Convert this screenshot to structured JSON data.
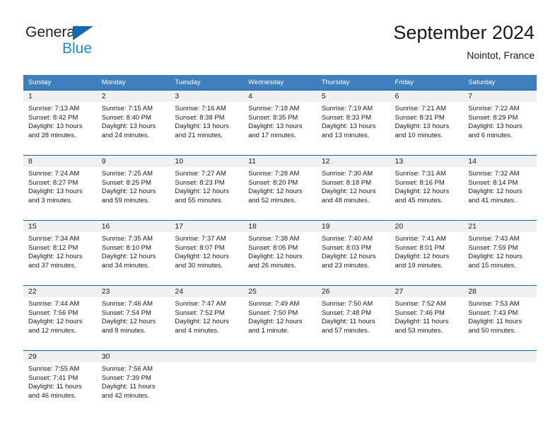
{
  "brand": {
    "line1": "General",
    "line2": "Blue",
    "triangle_color": "#1269b0"
  },
  "header": {
    "title": "September 2024",
    "location": "Nointot, France"
  },
  "colors": {
    "header_band": "#3f7fbf",
    "row_rule": "#1568ad",
    "daynum_band": "#f0f0f0",
    "brand_blue": "#1f88d8"
  },
  "weekday_headers": [
    "Sunday",
    "Monday",
    "Tuesday",
    "Wednesday",
    "Thursday",
    "Friday",
    "Saturday"
  ],
  "weeks": [
    [
      {
        "day": "1",
        "sunrise": "Sunrise: 7:13 AM",
        "sunset": "Sunset: 8:42 PM",
        "daylight1": "Daylight: 13 hours",
        "daylight2": "and 28 minutes."
      },
      {
        "day": "2",
        "sunrise": "Sunrise: 7:15 AM",
        "sunset": "Sunset: 8:40 PM",
        "daylight1": "Daylight: 13 hours",
        "daylight2": "and 24 minutes."
      },
      {
        "day": "3",
        "sunrise": "Sunrise: 7:16 AM",
        "sunset": "Sunset: 8:38 PM",
        "daylight1": "Daylight: 13 hours",
        "daylight2": "and 21 minutes."
      },
      {
        "day": "4",
        "sunrise": "Sunrise: 7:18 AM",
        "sunset": "Sunset: 8:35 PM",
        "daylight1": "Daylight: 13 hours",
        "daylight2": "and 17 minutes."
      },
      {
        "day": "5",
        "sunrise": "Sunrise: 7:19 AM",
        "sunset": "Sunset: 8:33 PM",
        "daylight1": "Daylight: 13 hours",
        "daylight2": "and 13 minutes."
      },
      {
        "day": "6",
        "sunrise": "Sunrise: 7:21 AM",
        "sunset": "Sunset: 8:31 PM",
        "daylight1": "Daylight: 13 hours",
        "daylight2": "and 10 minutes."
      },
      {
        "day": "7",
        "sunrise": "Sunrise: 7:22 AM",
        "sunset": "Sunset: 8:29 PM",
        "daylight1": "Daylight: 13 hours",
        "daylight2": "and 6 minutes."
      }
    ],
    [
      {
        "day": "8",
        "sunrise": "Sunrise: 7:24 AM",
        "sunset": "Sunset: 8:27 PM",
        "daylight1": "Daylight: 13 hours",
        "daylight2": "and 3 minutes."
      },
      {
        "day": "9",
        "sunrise": "Sunrise: 7:25 AM",
        "sunset": "Sunset: 8:25 PM",
        "daylight1": "Daylight: 12 hours",
        "daylight2": "and 59 minutes."
      },
      {
        "day": "10",
        "sunrise": "Sunrise: 7:27 AM",
        "sunset": "Sunset: 8:23 PM",
        "daylight1": "Daylight: 12 hours",
        "daylight2": "and 55 minutes."
      },
      {
        "day": "11",
        "sunrise": "Sunrise: 7:28 AM",
        "sunset": "Sunset: 8:20 PM",
        "daylight1": "Daylight: 12 hours",
        "daylight2": "and 52 minutes."
      },
      {
        "day": "12",
        "sunrise": "Sunrise: 7:30 AM",
        "sunset": "Sunset: 8:18 PM",
        "daylight1": "Daylight: 12 hours",
        "daylight2": "and 48 minutes."
      },
      {
        "day": "13",
        "sunrise": "Sunrise: 7:31 AM",
        "sunset": "Sunset: 8:16 PM",
        "daylight1": "Daylight: 12 hours",
        "daylight2": "and 45 minutes."
      },
      {
        "day": "14",
        "sunrise": "Sunrise: 7:32 AM",
        "sunset": "Sunset: 8:14 PM",
        "daylight1": "Daylight: 12 hours",
        "daylight2": "and 41 minutes."
      }
    ],
    [
      {
        "day": "15",
        "sunrise": "Sunrise: 7:34 AM",
        "sunset": "Sunset: 8:12 PM",
        "daylight1": "Daylight: 12 hours",
        "daylight2": "and 37 minutes."
      },
      {
        "day": "16",
        "sunrise": "Sunrise: 7:35 AM",
        "sunset": "Sunset: 8:10 PM",
        "daylight1": "Daylight: 12 hours",
        "daylight2": "and 34 minutes."
      },
      {
        "day": "17",
        "sunrise": "Sunrise: 7:37 AM",
        "sunset": "Sunset: 8:07 PM",
        "daylight1": "Daylight: 12 hours",
        "daylight2": "and 30 minutes."
      },
      {
        "day": "18",
        "sunrise": "Sunrise: 7:38 AM",
        "sunset": "Sunset: 8:05 PM",
        "daylight1": "Daylight: 12 hours",
        "daylight2": "and 26 minutes."
      },
      {
        "day": "19",
        "sunrise": "Sunrise: 7:40 AM",
        "sunset": "Sunset: 8:03 PM",
        "daylight1": "Daylight: 12 hours",
        "daylight2": "and 23 minutes."
      },
      {
        "day": "20",
        "sunrise": "Sunrise: 7:41 AM",
        "sunset": "Sunset: 8:01 PM",
        "daylight1": "Daylight: 12 hours",
        "daylight2": "and 19 minutes."
      },
      {
        "day": "21",
        "sunrise": "Sunrise: 7:43 AM",
        "sunset": "Sunset: 7:59 PM",
        "daylight1": "Daylight: 12 hours",
        "daylight2": "and 15 minutes."
      }
    ],
    [
      {
        "day": "22",
        "sunrise": "Sunrise: 7:44 AM",
        "sunset": "Sunset: 7:56 PM",
        "daylight1": "Daylight: 12 hours",
        "daylight2": "and 12 minutes."
      },
      {
        "day": "23",
        "sunrise": "Sunrise: 7:46 AM",
        "sunset": "Sunset: 7:54 PM",
        "daylight1": "Daylight: 12 hours",
        "daylight2": "and 8 minutes."
      },
      {
        "day": "24",
        "sunrise": "Sunrise: 7:47 AM",
        "sunset": "Sunset: 7:52 PM",
        "daylight1": "Daylight: 12 hours",
        "daylight2": "and 4 minutes."
      },
      {
        "day": "25",
        "sunrise": "Sunrise: 7:49 AM",
        "sunset": "Sunset: 7:50 PM",
        "daylight1": "Daylight: 12 hours",
        "daylight2": "and 1 minute."
      },
      {
        "day": "26",
        "sunrise": "Sunrise: 7:50 AM",
        "sunset": "Sunset: 7:48 PM",
        "daylight1": "Daylight: 11 hours",
        "daylight2": "and 57 minutes."
      },
      {
        "day": "27",
        "sunrise": "Sunrise: 7:52 AM",
        "sunset": "Sunset: 7:46 PM",
        "daylight1": "Daylight: 11 hours",
        "daylight2": "and 53 minutes."
      },
      {
        "day": "28",
        "sunrise": "Sunrise: 7:53 AM",
        "sunset": "Sunset: 7:43 PM",
        "daylight1": "Daylight: 11 hours",
        "daylight2": "and 50 minutes."
      }
    ],
    [
      {
        "day": "29",
        "sunrise": "Sunrise: 7:55 AM",
        "sunset": "Sunset: 7:41 PM",
        "daylight1": "Daylight: 11 hours",
        "daylight2": "and 46 minutes."
      },
      {
        "day": "30",
        "sunrise": "Sunrise: 7:56 AM",
        "sunset": "Sunset: 7:39 PM",
        "daylight1": "Daylight: 11 hours",
        "daylight2": "and 42 minutes."
      },
      {
        "day": "",
        "sunrise": "",
        "sunset": "",
        "daylight1": "",
        "daylight2": ""
      },
      {
        "day": "",
        "sunrise": "",
        "sunset": "",
        "daylight1": "",
        "daylight2": ""
      },
      {
        "day": "",
        "sunrise": "",
        "sunset": "",
        "daylight1": "",
        "daylight2": ""
      },
      {
        "day": "",
        "sunrise": "",
        "sunset": "",
        "daylight1": "",
        "daylight2": ""
      },
      {
        "day": "",
        "sunrise": "",
        "sunset": "",
        "daylight1": "",
        "daylight2": ""
      }
    ]
  ]
}
